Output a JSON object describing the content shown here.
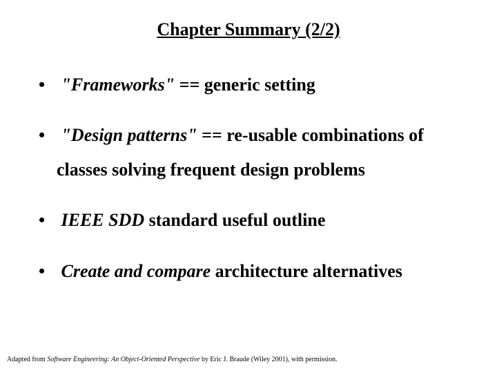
{
  "title": "Chapter Summary (2/2)",
  "bullets": [
    {
      "emph": "\"Frameworks\"",
      "rest": " == generic setting"
    },
    {
      "emph": "\"Design patterns\"",
      "rest": " == re-usable combinations of classes solving frequent design problems"
    },
    {
      "emph": "IEEE SDD",
      "rest": " standard useful outline"
    },
    {
      "emph": "Create and compare",
      "rest": " architecture alternatives"
    }
  ],
  "footer": {
    "prefix": "Adapted from ",
    "book": "Software Engineering: An Object-Oriented Perspective",
    "suffix": " by Eric J. Braude (Wiley 2001), with permission."
  }
}
